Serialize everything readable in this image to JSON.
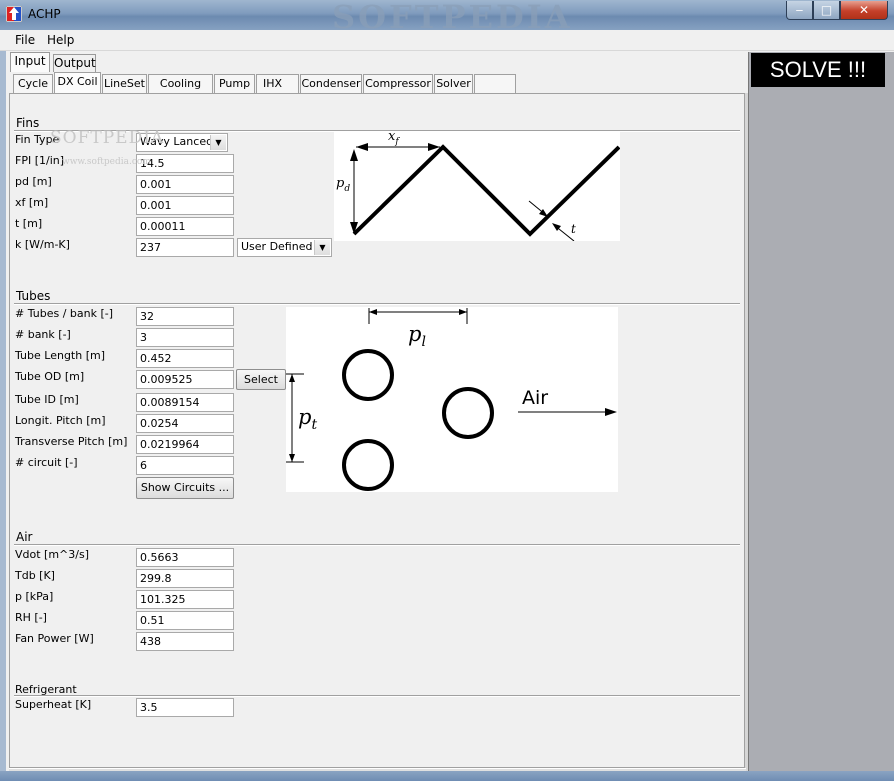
{
  "window": {
    "title": "ACHP",
    "watermark": "SOFTPEDIA",
    "minimize_glyph": "‒",
    "maximize_glyph": "□",
    "close_glyph": "✕"
  },
  "menu": [
    "File",
    "Help"
  ],
  "outer_tabs": [
    "Input",
    "Output"
  ],
  "inner_tabs": [
    "Cycle",
    "DX Coil",
    "LineSet",
    "Cooling Coil",
    "Pump",
    "IHX",
    "Condenser",
    "Compressor",
    "Solver",
    ""
  ],
  "solve_label": "SOLVE !!!",
  "fins": {
    "heading": "Fins",
    "labels": [
      "Fin Type",
      "FPI [1/in]",
      "pd [m]",
      "xf [m]",
      "t [m]",
      "k [W/m-K]"
    ],
    "fin_type": "Wavy Lanced",
    "values": [
      "14.5",
      "0.001",
      "0.001",
      "0.00011",
      "237"
    ],
    "k_mode": "User Defined",
    "diagram": {
      "x_label": "x",
      "x_sub": "f",
      "p_label": "p",
      "p_sub": "d",
      "t_label": "t"
    },
    "image_watermark": "SOFTPEDIA",
    "image_watermark_url": "www.softpedia.com"
  },
  "tubes": {
    "heading": "Tubes",
    "labels": [
      "# Tubes / bank [-]",
      "# bank [-]",
      "Tube Length [m]",
      "Tube OD [m]",
      "Tube ID [m]",
      "Longit. Pitch [m]",
      "Transverse Pitch [m]",
      "# circuit [-]"
    ],
    "values": [
      "32",
      "3",
      "0.452",
      "0.009525",
      "0.0089154",
      "0.0254",
      "0.0219964",
      "6"
    ],
    "select_label": "Select",
    "show_circuits_label": "Show Circuits ...",
    "diagram": {
      "pl_label": "p",
      "pl_sub": "l",
      "pt_label": "p",
      "pt_sub": "t",
      "air_label": "Air"
    }
  },
  "air": {
    "heading": "Air",
    "labels": [
      "Vdot [m^3/s]",
      "Tdb [K]",
      "p [kPa]",
      "RH [-]",
      "Fan Power [W]"
    ],
    "values": [
      "0.5663",
      "299.8",
      "101.325",
      "0.51",
      "438"
    ]
  },
  "refrigerant": {
    "heading": "Refrigerant",
    "labels": [
      "Superheat [K]"
    ],
    "values": [
      "3.5"
    ]
  },
  "colors": {
    "solve_bg": "#000000",
    "right_pane": "#abadb3",
    "title_bar": "#7f9bbd"
  }
}
